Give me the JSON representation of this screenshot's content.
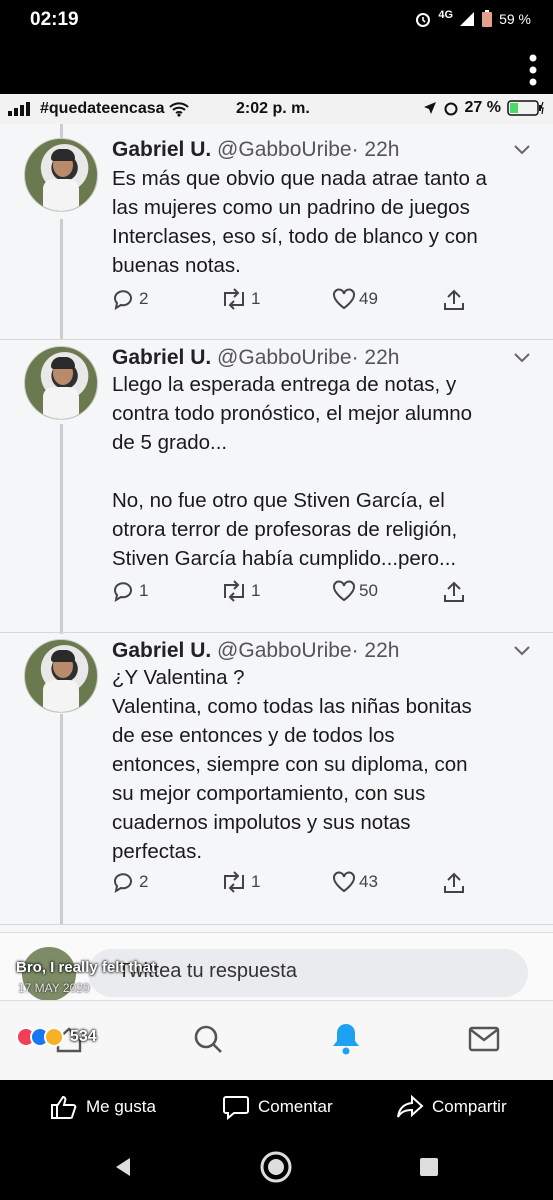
{
  "os_status": {
    "time": "02:19",
    "network": "4G",
    "battery": "59 %"
  },
  "ios_status": {
    "carrier": "#quedateencasa",
    "time": "2:02 p. m.",
    "battery": "27 %"
  },
  "tweets": [
    {
      "name": "Gabriel U.",
      "handle": "@GabboUribe",
      "age": "· 22h",
      "text": "Es más que obvio que nada atrae tanto a\nlas mujeres como un padrino de juegos\nInterclases, eso sí, todo de blanco y con\nbuenas notas.",
      "replies": "2",
      "retweets": "1",
      "likes": "49"
    },
    {
      "name": "Gabriel U.",
      "handle": "@GabboUribe",
      "age": "· 22h",
      "text": "Llego la esperada entrega de notas, y\ncontra todo pronóstico, el mejor alumno\nde 5 grado...\n\nNo, no fue otro que Stiven García, el\notrora terror de profesoras de religión,\nStiven García había cumplido...pero...",
      "replies": "1",
      "retweets": "1",
      "likes": "50"
    },
    {
      "name": "Gabriel U.",
      "handle": "@GabboUribe",
      "age": "· 22h",
      "text": "¿Y Valentina ?\nValentina, como todas las niñas bonitas\nde ese entonces y de todos los\nentonces, siempre con su diploma, con\nsu mejor comportamiento, con sus\ncuadernos impolutos y sus notas\nperfectas.",
      "replies": "2",
      "retweets": "1",
      "likes": "43"
    }
  ],
  "reply_placeholder": "Twittea tu respuesta",
  "fb_overlay": {
    "caption": "Bro, I really felt that",
    "date": "17 MAY 2020",
    "reaction_count": "534"
  },
  "fb_actions": {
    "like": "Me gusta",
    "comment": "Comentar",
    "share": "Compartir"
  },
  "colors": {
    "like_blue": "#1877f2",
    "love_red": "#f33e58",
    "haha_yellow": "#f7b125",
    "bell_blue": "#1da1f2"
  }
}
